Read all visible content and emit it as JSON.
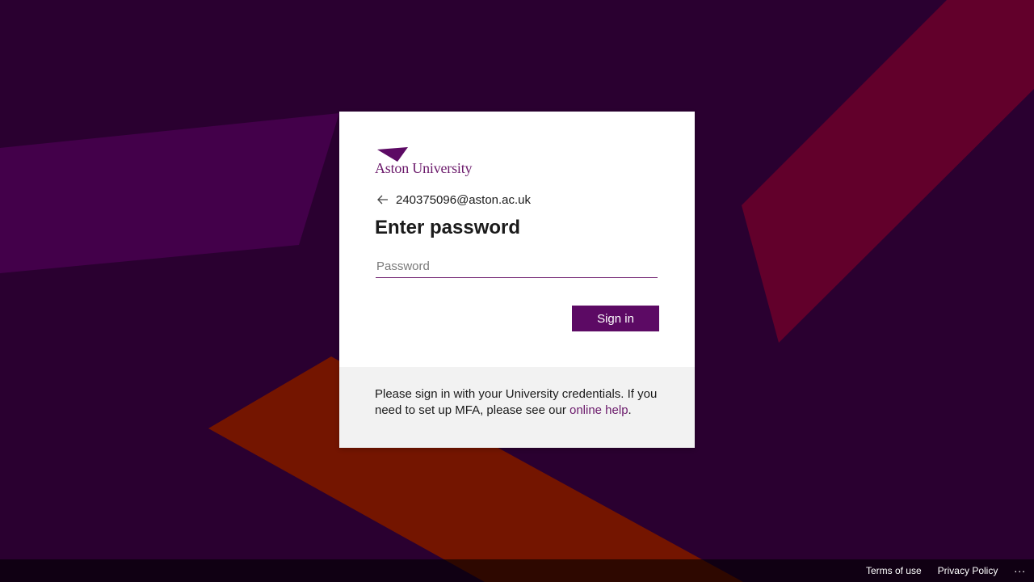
{
  "colors": {
    "background": "#2a0030",
    "brand_purple": "#5c0a64",
    "link": "#6b1a6b",
    "shape_purple": "#43004a",
    "shape_crimson": "#62002b",
    "shape_orange": "#741500"
  },
  "logo": {
    "text": "Aston University",
    "icon": "aston-triangle-logo"
  },
  "identity": {
    "back_icon": "back-arrow-icon",
    "email": "240375096@aston.ac.uk"
  },
  "title": "Enter password",
  "password": {
    "placeholder": "Password",
    "value": ""
  },
  "signin_label": "Sign in",
  "footer": {
    "text_before": "Please sign in with your University credentials. If you need to set up MFA, please see our ",
    "link_text": "online help",
    "text_after": "."
  },
  "bottom_bar": {
    "terms": "Terms of use",
    "privacy": "Privacy Policy",
    "more": "..."
  }
}
